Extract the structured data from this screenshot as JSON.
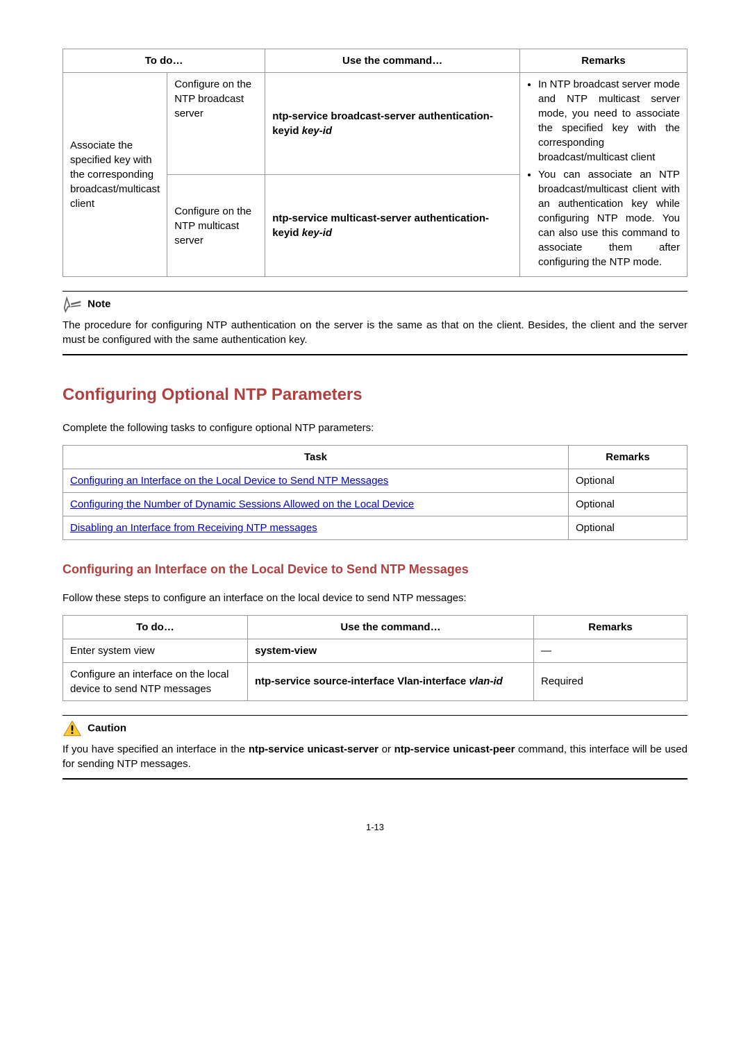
{
  "table1": {
    "headers": {
      "c1": "To do…",
      "c2": "Use the command…",
      "c3": "Remarks"
    },
    "rowspan_cell": "Associate the specified key with the corresponding broadcast/multicast client",
    "row1_sub": "Configure on the NTP broadcast server",
    "row1_cmd_bold": "ntp-service broadcast-server authentication-keyid",
    "row1_cmd_italic": " key-id",
    "row2_sub": "Configure on the NTP multicast server",
    "row2_cmd_bold": "ntp-service multicast-server authentication-keyid",
    "row2_cmd_italic": " key-id",
    "remark_li1": "In NTP broadcast server mode and NTP multicast server mode, you need to associate the specified key with the corresponding broadcast/multicast client",
    "remark_li2": "You can associate an NTP broadcast/multicast client with an authentication key while configuring NTP mode. You can also use this command to associate them after configuring the NTP mode."
  },
  "note": {
    "label": "Note",
    "text": "The procedure for configuring NTP authentication on the server is the same as that on the client. Besides, the client and the server must be configured with the same authentication key."
  },
  "section_heading": "Configuring Optional NTP Parameters",
  "section_intro": "Complete the following tasks to configure optional NTP parameters:",
  "task_table": {
    "h1": "Task",
    "h2": "Remarks",
    "r1_link": "Configuring an Interface on the Local Device to Send NTP Messages",
    "r1_remark": "Optional",
    "r2_link": "Configuring the Number of Dynamic Sessions Allowed on the Local Device",
    "r2_remark": "Optional",
    "r3_link": "Disabling an Interface from Receiving NTP messages",
    "r3_remark": "Optional"
  },
  "subsection_heading": "Configuring an Interface on the Local Device to Send NTP Messages",
  "subsection_intro": "Follow these steps to configure an interface on the local device to send NTP messages:",
  "steps_table": {
    "h1": "To do…",
    "h2": "Use the command…",
    "h3": "Remarks",
    "r1c1": "Enter system view",
    "r1c2": "system-view",
    "r1c3": "—",
    "r2c1": "Configure an interface on the local device to send NTP messages",
    "r2c2_bold": "ntp-service source-interface Vlan-interface",
    "r2c2_italic": " vlan-id",
    "r2c3": "Required"
  },
  "caution": {
    "label": "Caution",
    "text_pre": "If you have specified an interface in the ",
    "text_b1": "ntp-service unicast-server",
    "text_mid": " or ",
    "text_b2": "ntp-service unicast-peer",
    "text_post": " command, this interface will be used for sending NTP messages."
  },
  "page_number": "1-13"
}
